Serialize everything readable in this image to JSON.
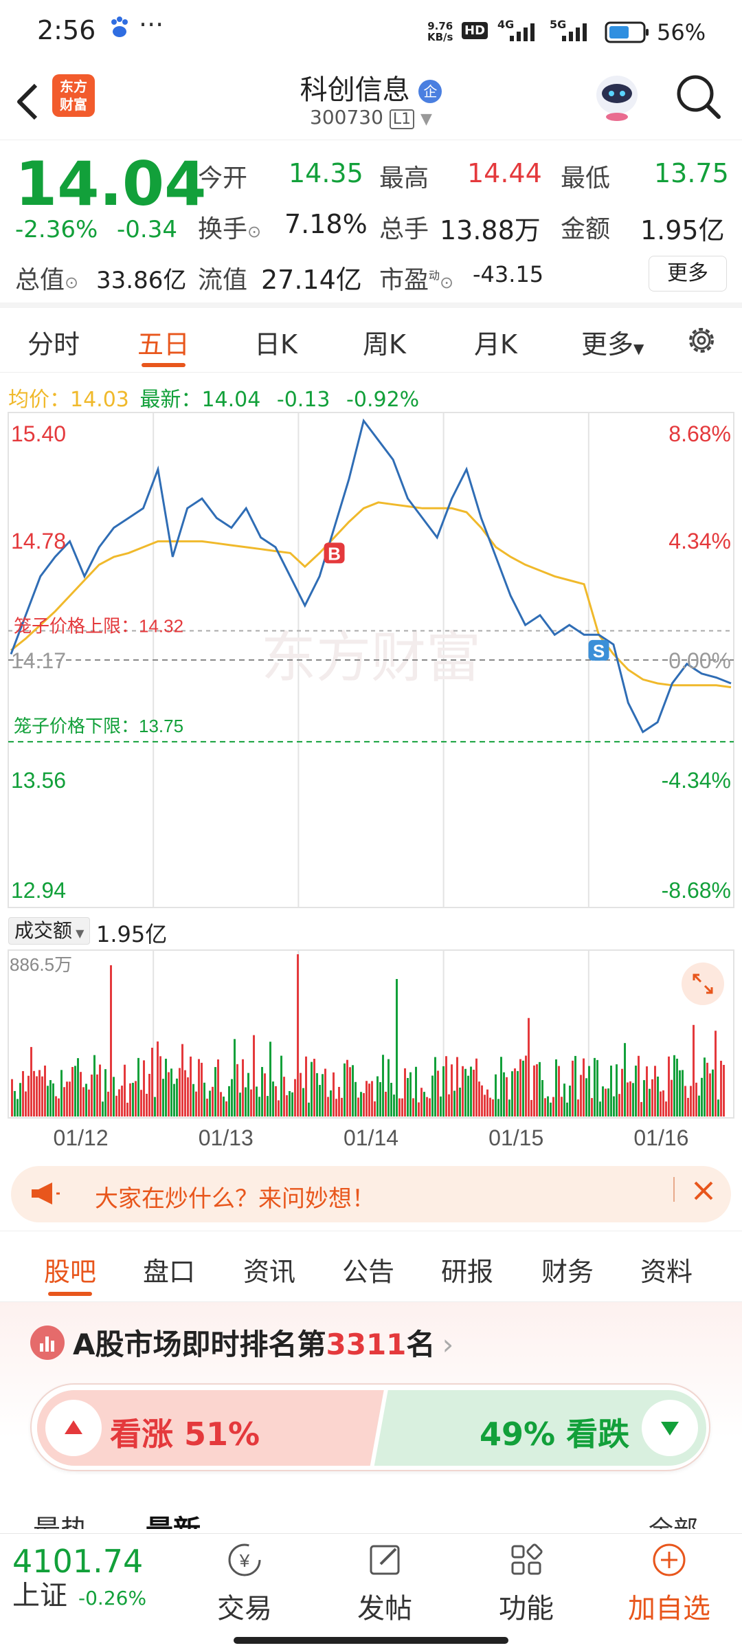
{
  "status_bar": {
    "time": "2:56",
    "net_speed_value": "9.76",
    "net_speed_unit": "KB/s",
    "hd_badge": "HD",
    "net_4g": "4G",
    "net_5g": "5G",
    "battery": "56%"
  },
  "nav": {
    "logo_line1": "东方",
    "logo_line2": "财富",
    "stock_name": "科创信息",
    "enterprise_badge": "企",
    "stock_code": "300730",
    "level_badge": "L1"
  },
  "quote": {
    "price": "14.04",
    "change_pct": "-2.36%",
    "change": "-0.34",
    "open_label": "今开",
    "open": "14.35",
    "high_label": "最高",
    "high": "14.44",
    "low_label": "最低",
    "low": "13.75",
    "turnover_label": "换手",
    "turnover": "7.18%",
    "volume_label": "总手",
    "volume": "13.88万",
    "amount_label": "金额",
    "amount": "1.95亿",
    "mktcap_label": "总值",
    "mktcap": "33.86亿",
    "float_label": "流值",
    "float_cap": "27.14亿",
    "pe_label": "市盈",
    "pe_sup": "动",
    "pe": "-43.15",
    "more_button": "更多"
  },
  "period_tabs": [
    "分时",
    "五日",
    "日K",
    "周K",
    "月K",
    "更多"
  ],
  "active_period": "五日",
  "chart_legend": {
    "avg_label": "均价：",
    "avg": "14.03",
    "latest_label": "最新：",
    "latest": "14.04",
    "change": "-0.13",
    "change_pct": "-0.92%"
  },
  "chart_data": {
    "type": "line",
    "y_ticks_left": [
      "15.40",
      "14.78",
      "14.17",
      "13.56",
      "12.94"
    ],
    "y_ticks_right": [
      "8.68%",
      "4.34%",
      "0.00%",
      "-4.34%",
      "-8.68%"
    ],
    "ylim": [
      12.94,
      15.4
    ],
    "prev_close": 14.17,
    "x_labels": [
      "01/12",
      "01/13",
      "01/14",
      "01/15",
      "01/16"
    ],
    "cage_upper_label": "笼子价格上限：14.32",
    "cage_upper": 14.32,
    "cage_lower_label": "笼子价格下限：13.75",
    "cage_lower": 13.75,
    "series": [
      {
        "name": "最新",
        "color": "#2f6db5",
        "values": [
          14.2,
          14.4,
          14.6,
          14.7,
          14.78,
          14.6,
          14.75,
          14.85,
          14.9,
          14.95,
          15.15,
          14.7,
          14.95,
          15.0,
          14.9,
          14.85,
          14.95,
          14.8,
          14.75,
          14.6,
          14.45,
          14.6,
          14.85,
          15.1,
          15.4,
          15.3,
          15.2,
          15.0,
          14.9,
          14.8,
          15.0,
          15.15,
          14.9,
          14.7,
          14.5,
          14.35,
          14.4,
          14.3,
          14.35,
          14.3,
          14.3,
          14.25,
          13.95,
          13.8,
          13.85,
          14.05,
          14.15,
          14.1,
          14.08,
          14.05
        ]
      },
      {
        "name": "均价",
        "color": "#f0b92b",
        "values": [
          14.22,
          14.28,
          14.35,
          14.42,
          14.5,
          14.58,
          14.66,
          14.7,
          14.72,
          14.75,
          14.78,
          14.78,
          14.78,
          14.78,
          14.77,
          14.76,
          14.75,
          14.74,
          14.73,
          14.72,
          14.65,
          14.72,
          14.8,
          14.88,
          14.95,
          14.98,
          14.97,
          14.96,
          14.95,
          14.95,
          14.95,
          14.93,
          14.85,
          14.75,
          14.7,
          14.66,
          14.63,
          14.6,
          14.58,
          14.56,
          14.3,
          14.2,
          14.12,
          14.07,
          14.05,
          14.04,
          14.04,
          14.04,
          14.04,
          14.03
        ]
      }
    ],
    "markers": [
      {
        "label": "B",
        "color": "#e4393c"
      },
      {
        "label": "S",
        "color": "#3b8fd8"
      }
    ],
    "watermark": "东方财富",
    "volume_selector": "成交额",
    "volume_total": "1.95亿",
    "volume_max_label": "886.5万"
  },
  "ask_banner": {
    "text": "大家在炒什么？来问妙想！"
  },
  "forum_tabs": [
    "股吧",
    "盘口",
    "资讯",
    "公告",
    "研报",
    "财务",
    "资料"
  ],
  "active_forum_tab": "股吧",
  "rank": {
    "prefix": "A股市场即时排名第",
    "number": "3311",
    "suffix": "名"
  },
  "sentiment": {
    "up_label": "看涨",
    "up_pct": "51%",
    "down_pct": "49%",
    "down_label": "看跌",
    "up_share": 0.51
  },
  "hidden_tabs": {
    "left": "最热",
    "mid": "最新",
    "right": "全部"
  },
  "bottom_bar": {
    "index_value": "4101.74",
    "index_name": "上证",
    "index_change": "-0.26%",
    "trade": "交易",
    "post": "发帖",
    "function": "功能",
    "add_watch": "加自选"
  }
}
